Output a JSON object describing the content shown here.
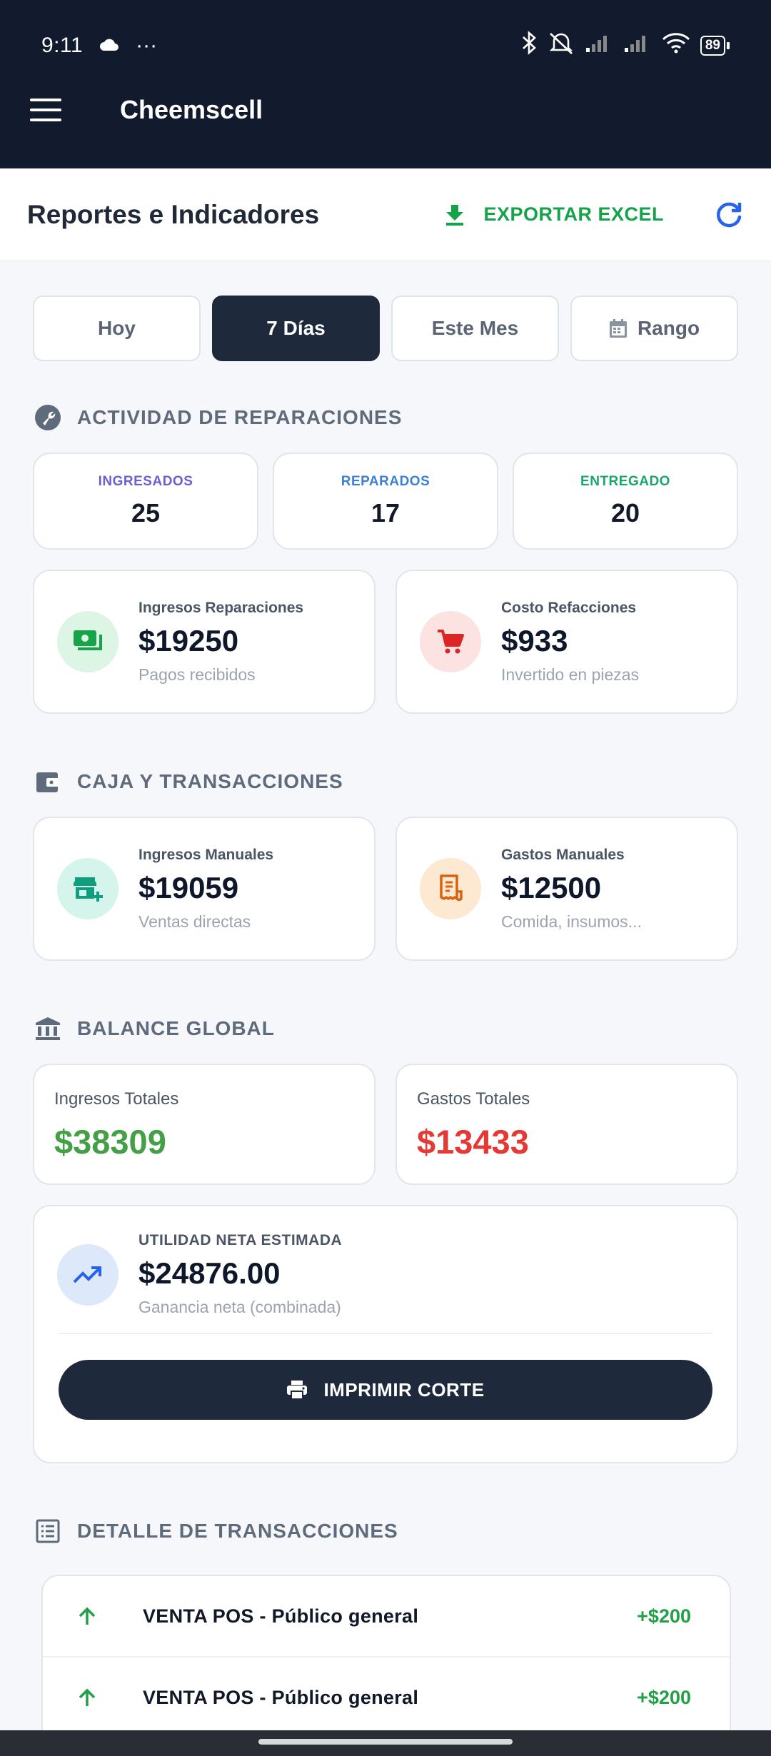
{
  "status_bar": {
    "time": "9:11",
    "extra": "···",
    "battery": "89"
  },
  "app": {
    "title": "Cheemscell"
  },
  "header": {
    "title": "Reportes e Indicadores",
    "export_label": "EXPORTAR EXCEL"
  },
  "tabs": [
    {
      "label": "Hoy",
      "active": false
    },
    {
      "label": "7 Días",
      "active": true
    },
    {
      "label": "Este Mes",
      "active": false
    },
    {
      "label": "Rango",
      "active": false
    }
  ],
  "repairs": {
    "title": "ACTIVIDAD DE REPARACIONES",
    "counts": [
      {
        "label": "INGRESADOS",
        "value": "25",
        "color": "#6b5fd3"
      },
      {
        "label": "REPARADOS",
        "value": "17",
        "color": "#3b7fd9"
      },
      {
        "label": "ENTREGADO",
        "value": "20",
        "color": "#1aa56b"
      }
    ],
    "income": {
      "label": "Ingresos Reparaciones",
      "value": "$19250",
      "sub": "Pagos recibidos"
    },
    "cost": {
      "label": "Costo Refacciones",
      "value": "$933",
      "sub": "Invertido en piezas"
    }
  },
  "cash": {
    "title": "CAJA Y TRANSACCIONES",
    "income": {
      "label": "Ingresos Manuales",
      "value": "$19059",
      "sub": "Ventas directas"
    },
    "expense": {
      "label": "Gastos Manuales",
      "value": "$12500",
      "sub": "Comida, insumos..."
    }
  },
  "balance": {
    "title": "BALANCE GLOBAL",
    "income": {
      "label": "Ingresos Totales",
      "value": "$38309",
      "color": "#43a047"
    },
    "expense": {
      "label": "Gastos Totales",
      "value": "$13433",
      "color": "#e53935"
    },
    "net": {
      "label": "UTILIDAD NETA ESTIMADA",
      "value": "$24876.00",
      "sub": "Ganancia neta (combinada)"
    },
    "print_label": "IMPRIMIR CORTE"
  },
  "transactions": {
    "title": "DETALLE DE TRANSACCIONES",
    "items": [
      {
        "description": "VENTA POS - Público general",
        "amount": "+$200"
      },
      {
        "description": "VENTA POS - Público general",
        "amount": "+$200"
      }
    ]
  }
}
